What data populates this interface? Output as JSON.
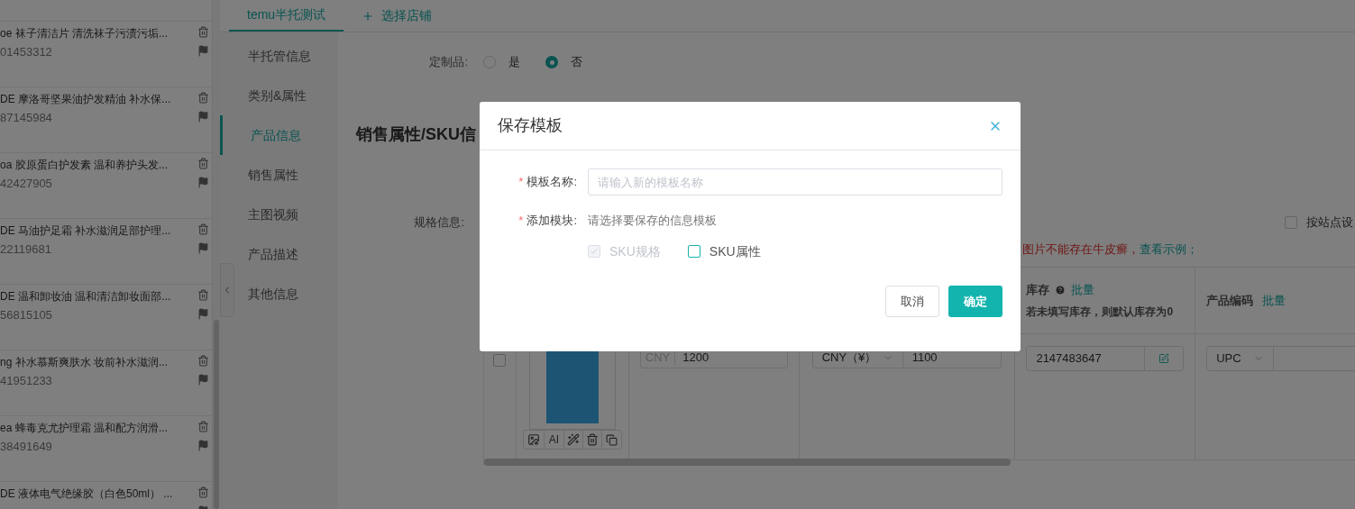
{
  "product_list": [
    {
      "title": "oe 袜子清洁片 清洗袜子污渍污垢...",
      "code": "01453312"
    },
    {
      "title": "DE 摩洛哥坚果油护发精油 补水保...",
      "code": "87145984"
    },
    {
      "title": "oa 胶原蛋白护发素 温和养护头发...",
      "code": "42427905"
    },
    {
      "title": "DE 马油护足霜 补水滋润足部护理...",
      "code": "22119681"
    },
    {
      "title": "DE 温和卸妆油 温和清洁卸妆面部...",
      "code": "56815105"
    },
    {
      "title": "ng 补水慕斯爽肤水 妆前补水滋润...",
      "code": "41951233"
    },
    {
      "title": "ea 蜂毒克尤护理霜 温和配方润滑...",
      "code": "38491649"
    },
    {
      "title": "DE 液体电气绝缘胶（白色50ml） ..."
    }
  ],
  "tabs": [
    {
      "label": "temu半托测试",
      "selected": true
    }
  ],
  "add_store": "选择店铺",
  "side_nav": [
    {
      "label": "半托管信息",
      "selected": false
    },
    {
      "label": "类别&属性",
      "selected": false
    },
    {
      "label": "产品信息",
      "selected": true
    },
    {
      "label": "销售属性",
      "selected": false
    },
    {
      "label": "主图视频",
      "selected": false
    },
    {
      "label": "产品描述",
      "selected": false
    },
    {
      "label": "其他信息",
      "selected": false
    }
  ],
  "custom": {
    "label": "定制品:",
    "options": [
      {
        "label": "是",
        "selected": false
      },
      {
        "label": "否",
        "selected": true
      }
    ]
  },
  "section_title": "销售属性/SKU信",
  "spec_label": "规格信息:",
  "site_setting": {
    "label": "按站点设",
    "checked": false
  },
  "warning": {
    "text": "图片不能存在牛皮癣，",
    "link": "查看示例；"
  },
  "table": {
    "columns": [
      {
        "title": "库存",
        "action": "批量",
        "hint": "若未填写库存，则默认库存为0"
      },
      {
        "title": "产品编码",
        "action": "批量"
      }
    ],
    "row": {
      "checked": false,
      "image_tool_label": "AI",
      "price_currency": "CNY",
      "price": "1200",
      "sale_currency": "CNY（¥）",
      "sale_price": "1100",
      "stock": "2147483647",
      "code_type": "UPC"
    }
  },
  "dialog": {
    "title": "保存模板",
    "required_mark": "*",
    "name_label": "模板名称:",
    "name_placeholder": "请输入新的模板名称",
    "module_label": "添加模块:",
    "module_hint": "请选择要保存的信息模板",
    "modules": [
      {
        "label": "SKU规格",
        "checked": true,
        "disabled": true
      },
      {
        "label": "SKU属性",
        "checked": false,
        "disabled": false
      }
    ],
    "buttons": [
      {
        "label": "取消",
        "kind": "secondary"
      },
      {
        "label": "确定",
        "kind": "primary"
      }
    ]
  }
}
